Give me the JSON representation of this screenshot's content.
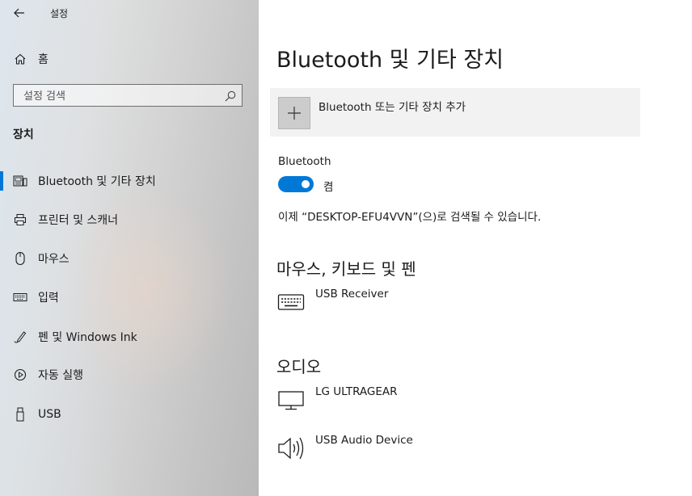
{
  "window": {
    "title": "설정"
  },
  "sidebar": {
    "home_label": "홈",
    "search_placeholder": "설정 검색",
    "section_title": "장치",
    "items": [
      {
        "label": "Bluetooth 및 기타 장치",
        "icon": "bluetooth-device-icon",
        "active": true
      },
      {
        "label": "프린터 및 스캐너",
        "icon": "printer-icon",
        "active": false
      },
      {
        "label": "마우스",
        "icon": "mouse-icon",
        "active": false
      },
      {
        "label": "입력",
        "icon": "keyboard-icon",
        "active": false
      },
      {
        "label": "펜 및 Windows Ink",
        "icon": "pen-icon",
        "active": false
      },
      {
        "label": "자동 실행",
        "icon": "autoplay-icon",
        "active": false
      },
      {
        "label": "USB",
        "icon": "usb-icon",
        "active": false
      }
    ]
  },
  "main": {
    "title": "Bluetooth 및 기타 장치",
    "add_device_label": "Bluetooth 또는 기타 장치 추가",
    "bluetooth": {
      "heading": "Bluetooth",
      "state_label": "켬",
      "enabled": true,
      "discoverable_text": "이제 “DESKTOP-EFU4VVN”(으)로 검색될 수 있습니다."
    },
    "groups": [
      {
        "title": "마우스, 키보드 및 펜",
        "devices": [
          {
            "name": "USB Receiver",
            "icon": "keyboard-icon"
          }
        ]
      },
      {
        "title": "오디오",
        "devices": [
          {
            "name": "LG ULTRAGEAR",
            "icon": "monitor-icon"
          },
          {
            "name": "USB Audio Device",
            "icon": "speaker-icon"
          }
        ]
      }
    ]
  },
  "colors": {
    "accent": "#0078d7",
    "add_tile_bg": "#f2f2f2",
    "plus_tile_bg": "#cccccc"
  }
}
